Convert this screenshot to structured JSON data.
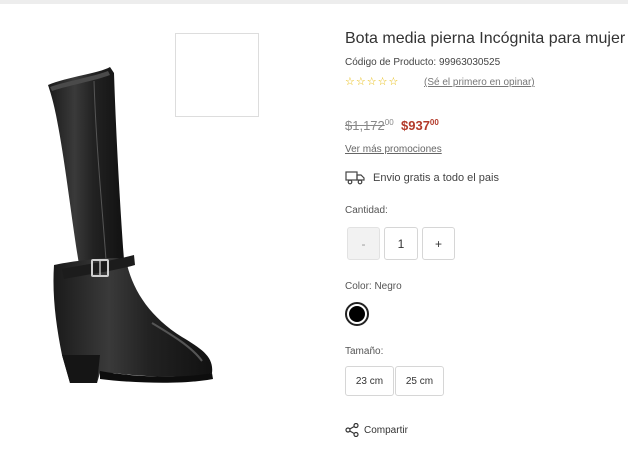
{
  "product": {
    "title": "Bota media pierna Incógnita para mujer",
    "code": "Código de Producto: 99963030525",
    "rating": 0,
    "stars": [
      "☆",
      "☆",
      "☆",
      "☆",
      "☆"
    ],
    "review_link": "(Sé el primero en opinar)",
    "price_old": "$1,172",
    "price_old_cents": "00",
    "price_new": "$937",
    "price_new_cents": "00",
    "promotions_link": "Ver más promociones",
    "shipping_text": "Envio gratis a todo el pais"
  },
  "quantity": {
    "label": "Cantidad:",
    "minus": "-",
    "value": "1",
    "plus": "+"
  },
  "color": {
    "label": "Color: Negro",
    "swatch_hex": "#000000"
  },
  "size": {
    "label": "Tamaño:",
    "options": [
      "23 cm",
      "25 cm"
    ]
  },
  "share": {
    "label": "Compartir"
  },
  "icons": {
    "shipping": "truck-icon",
    "share": "share-icon"
  },
  "colors": {
    "sale_price": "#b33a2a",
    "star": "#e6b800"
  }
}
